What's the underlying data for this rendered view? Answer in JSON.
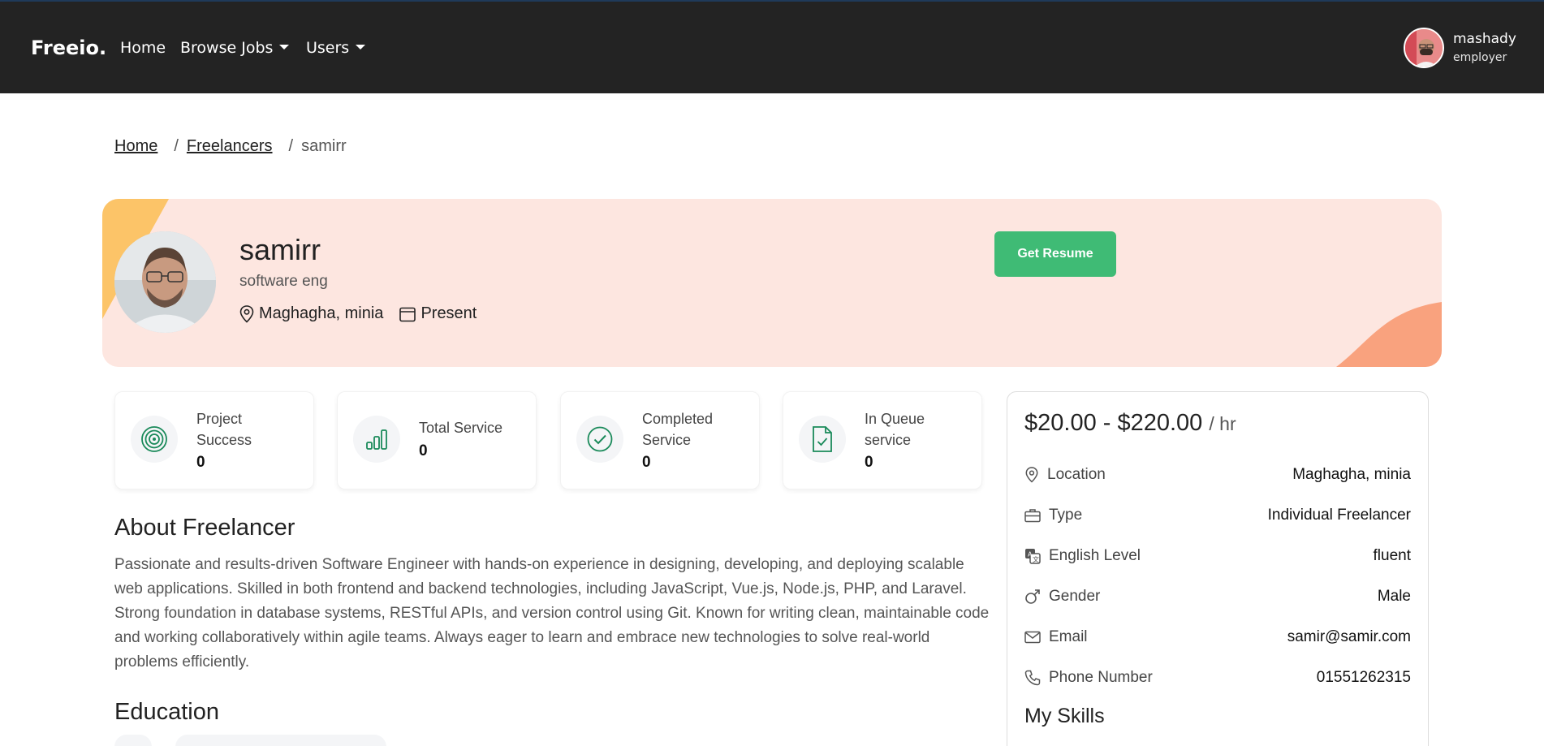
{
  "nav": {
    "brand": "Freeio.",
    "links": [
      {
        "label": "Home"
      },
      {
        "label": "Browse Jobs"
      },
      {
        "label": "Users"
      }
    ],
    "user": {
      "name": "mashady",
      "role": "employer"
    }
  },
  "breadcrumb": {
    "home": "Home",
    "freelancers": "Freelancers",
    "current": "samirr",
    "separator": "/"
  },
  "profile": {
    "name": "samirr",
    "title": "software eng",
    "location": "Maghagha, minia",
    "period": "Present",
    "resume_button": "Get Resume"
  },
  "stats": [
    {
      "label_line1": "Project",
      "label_line2": "Success",
      "value": "0",
      "icon": "target-icon"
    },
    {
      "label_line1": "Total Service",
      "label_line2": "",
      "value": "0",
      "icon": "bar-chart-icon"
    },
    {
      "label_line1": "Completed",
      "label_line2": "Service",
      "value": "0",
      "icon": "check-circle-icon"
    },
    {
      "label_line1": "In Queue",
      "label_line2": "service",
      "value": "0",
      "icon": "file-check-icon"
    }
  ],
  "about": {
    "heading": "About Freelancer",
    "text": "Passionate and results-driven Software Engineer with hands-on experience in designing, developing, and deploying scalable web applications. Skilled in both frontend and backend technologies, including JavaScript, Vue.js, Node.js, PHP, and Laravel. Strong foundation in database systems, RESTful APIs, and version control using Git. Known for writing clean, maintainable code and working collaboratively within agile teams. Always eager to learn and embrace new technologies to solve real-world problems efficiently."
  },
  "education": {
    "heading": "Education"
  },
  "sidebar": {
    "rate": "$20.00 - $220.00",
    "rate_unit": "/ hr",
    "rows": [
      {
        "label": "Location",
        "value": "Maghagha, minia",
        "icon": "map-pin-icon"
      },
      {
        "label": "Type",
        "value": "Individual Freelancer",
        "icon": "briefcase-icon"
      },
      {
        "label": "English Level",
        "value": "fluent",
        "icon": "translate-icon"
      },
      {
        "label": "Gender",
        "value": "Male",
        "icon": "gender-male-icon"
      },
      {
        "label": "Email",
        "value": "samir@samir.com",
        "icon": "envelope-icon"
      },
      {
        "label": "Phone Number",
        "value": "01551262315",
        "icon": "phone-icon"
      }
    ],
    "skills_heading": "My Skills"
  },
  "colors": {
    "navbar": "#232323",
    "banner": "#fde6e0",
    "accent_green": "#3fbb75",
    "icon_green": "#1a8a5a",
    "banner_corner_yellow": "#fcc468",
    "banner_corner_orange": "#f9a27e"
  }
}
